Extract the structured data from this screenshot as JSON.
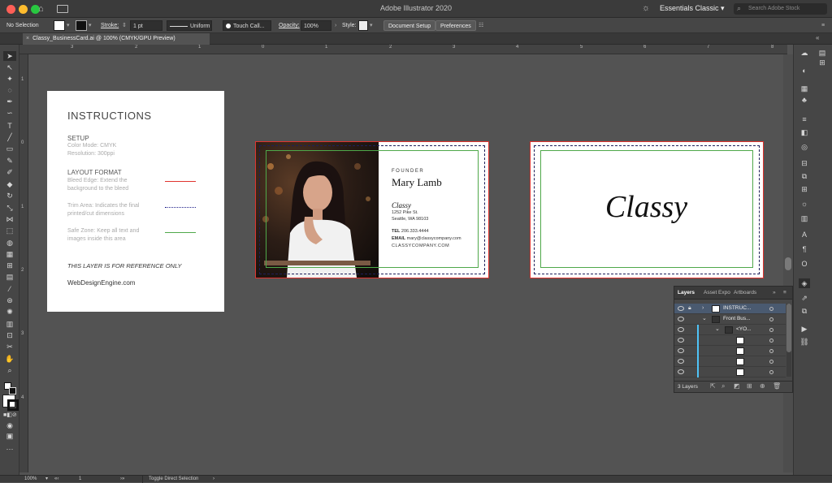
{
  "window": {
    "title": "Adobe Illustrator 2020"
  },
  "colors": {
    "bleed": "#e0332e",
    "trim": "#1f1f5a",
    "safe": "#4fa84a",
    "layer_highlight": "#4a5a70",
    "layer_color": "#4fc3f7"
  },
  "menubar": {
    "workspace": "Essentials Classic",
    "search_placeholder": "Search Adobe Stock"
  },
  "control_bar": {
    "selection": "No Selection",
    "stroke_label": "Stroke:",
    "stroke_value": "1 pt",
    "stroke_profile": "Uniform",
    "brush": "Touch Call...",
    "opacity_label": "Opacity:",
    "opacity_value": "100%",
    "style_label": "Style:",
    "document_setup": "Document Setup",
    "preferences": "Preferences"
  },
  "document_tab": {
    "label": "Classy_BusinessCard.ai @ 100% (CMYK/GPU Preview)"
  },
  "rulers": {
    "horizontal": [
      "3",
      "2",
      "1",
      "0",
      "1",
      "2",
      "3",
      "4",
      "5",
      "6",
      "7",
      "8"
    ],
    "vertical": [
      "1",
      "0",
      "1",
      "2",
      "3",
      "4"
    ]
  },
  "instructions": {
    "title": "INSTRUCTIONS",
    "setup_heading": "SETUP",
    "setup_line1": "Color Mode: CMYK",
    "setup_line2": "Resolution: 300ppi",
    "layout_heading": "LAYOUT FORMAT",
    "bleed_line1": "Bleed Edge: Extend the",
    "bleed_line2": "background to the bleed",
    "trim_line1": "Trim Area: Indicates the final",
    "trim_line2": "printed/cut dimensions",
    "safe_line1": "Safe Zone: Keep all text and",
    "safe_line2": "images inside this area",
    "reference_note": "THIS LAYER IS FOR REFERENCE ONLY",
    "site": "WebDesignEngine.com"
  },
  "front_card": {
    "role": "FOUNDER",
    "name": "Mary Lamb",
    "company": "Classy",
    "address1": "1252 Pike St.",
    "address2": "Seattle, WA 98103",
    "tel_label": "TEL",
    "tel": "206.333.4444",
    "email_label": "EMAIL",
    "email": "mary@classycompany.com",
    "website": "CLASSYCOMPANY.COM"
  },
  "back_card": {
    "logo": "Classy"
  },
  "layers_panel": {
    "tabs": [
      "Layers",
      "Asset Expo",
      "Artboards"
    ],
    "rows": [
      {
        "name": "INSTRUC..."
      },
      {
        "name": "Front Bus..."
      },
      {
        "name": "<YO..."
      }
    ],
    "count": "3 Layers"
  },
  "status_bar": {
    "zoom": "100%",
    "artboard": "1",
    "tool": "Toggle Direct Selection"
  }
}
